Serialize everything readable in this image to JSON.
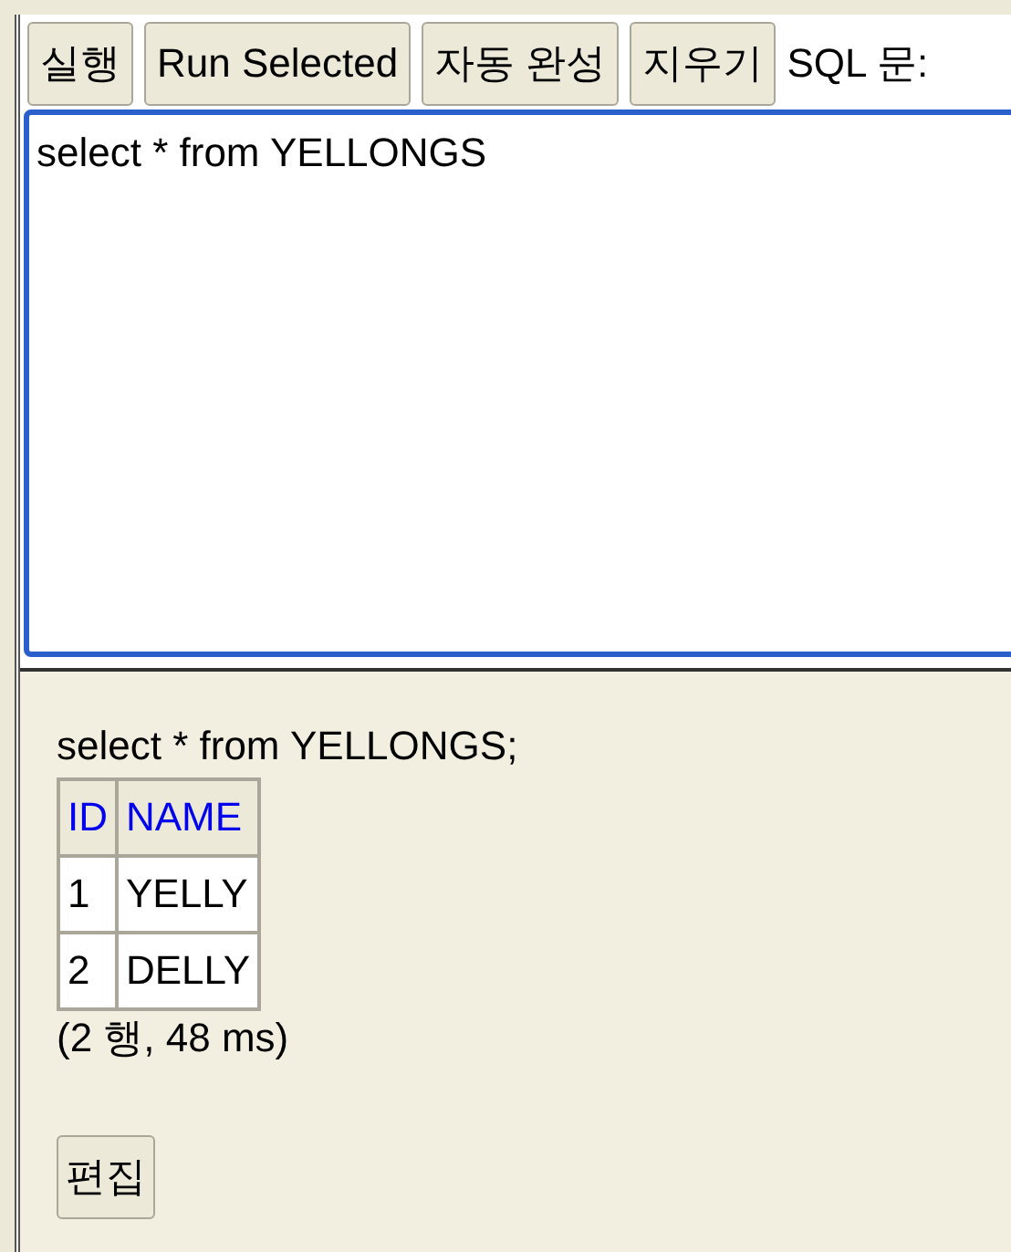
{
  "toolbar": {
    "buttons": [
      "실행",
      "Run Selected",
      "자동 완성",
      "지우기"
    ],
    "label": "SQL 문:"
  },
  "editor": {
    "value": "select * from YELLONGS"
  },
  "result": {
    "statement": "select * from YELLONGS;",
    "table": {
      "columns": [
        "ID",
        "NAME"
      ],
      "rows": [
        [
          "1",
          "YELLY"
        ],
        [
          "2",
          "DELLY"
        ]
      ]
    },
    "summary": "(2 행, 48 ms)",
    "edit_button": "편집"
  }
}
